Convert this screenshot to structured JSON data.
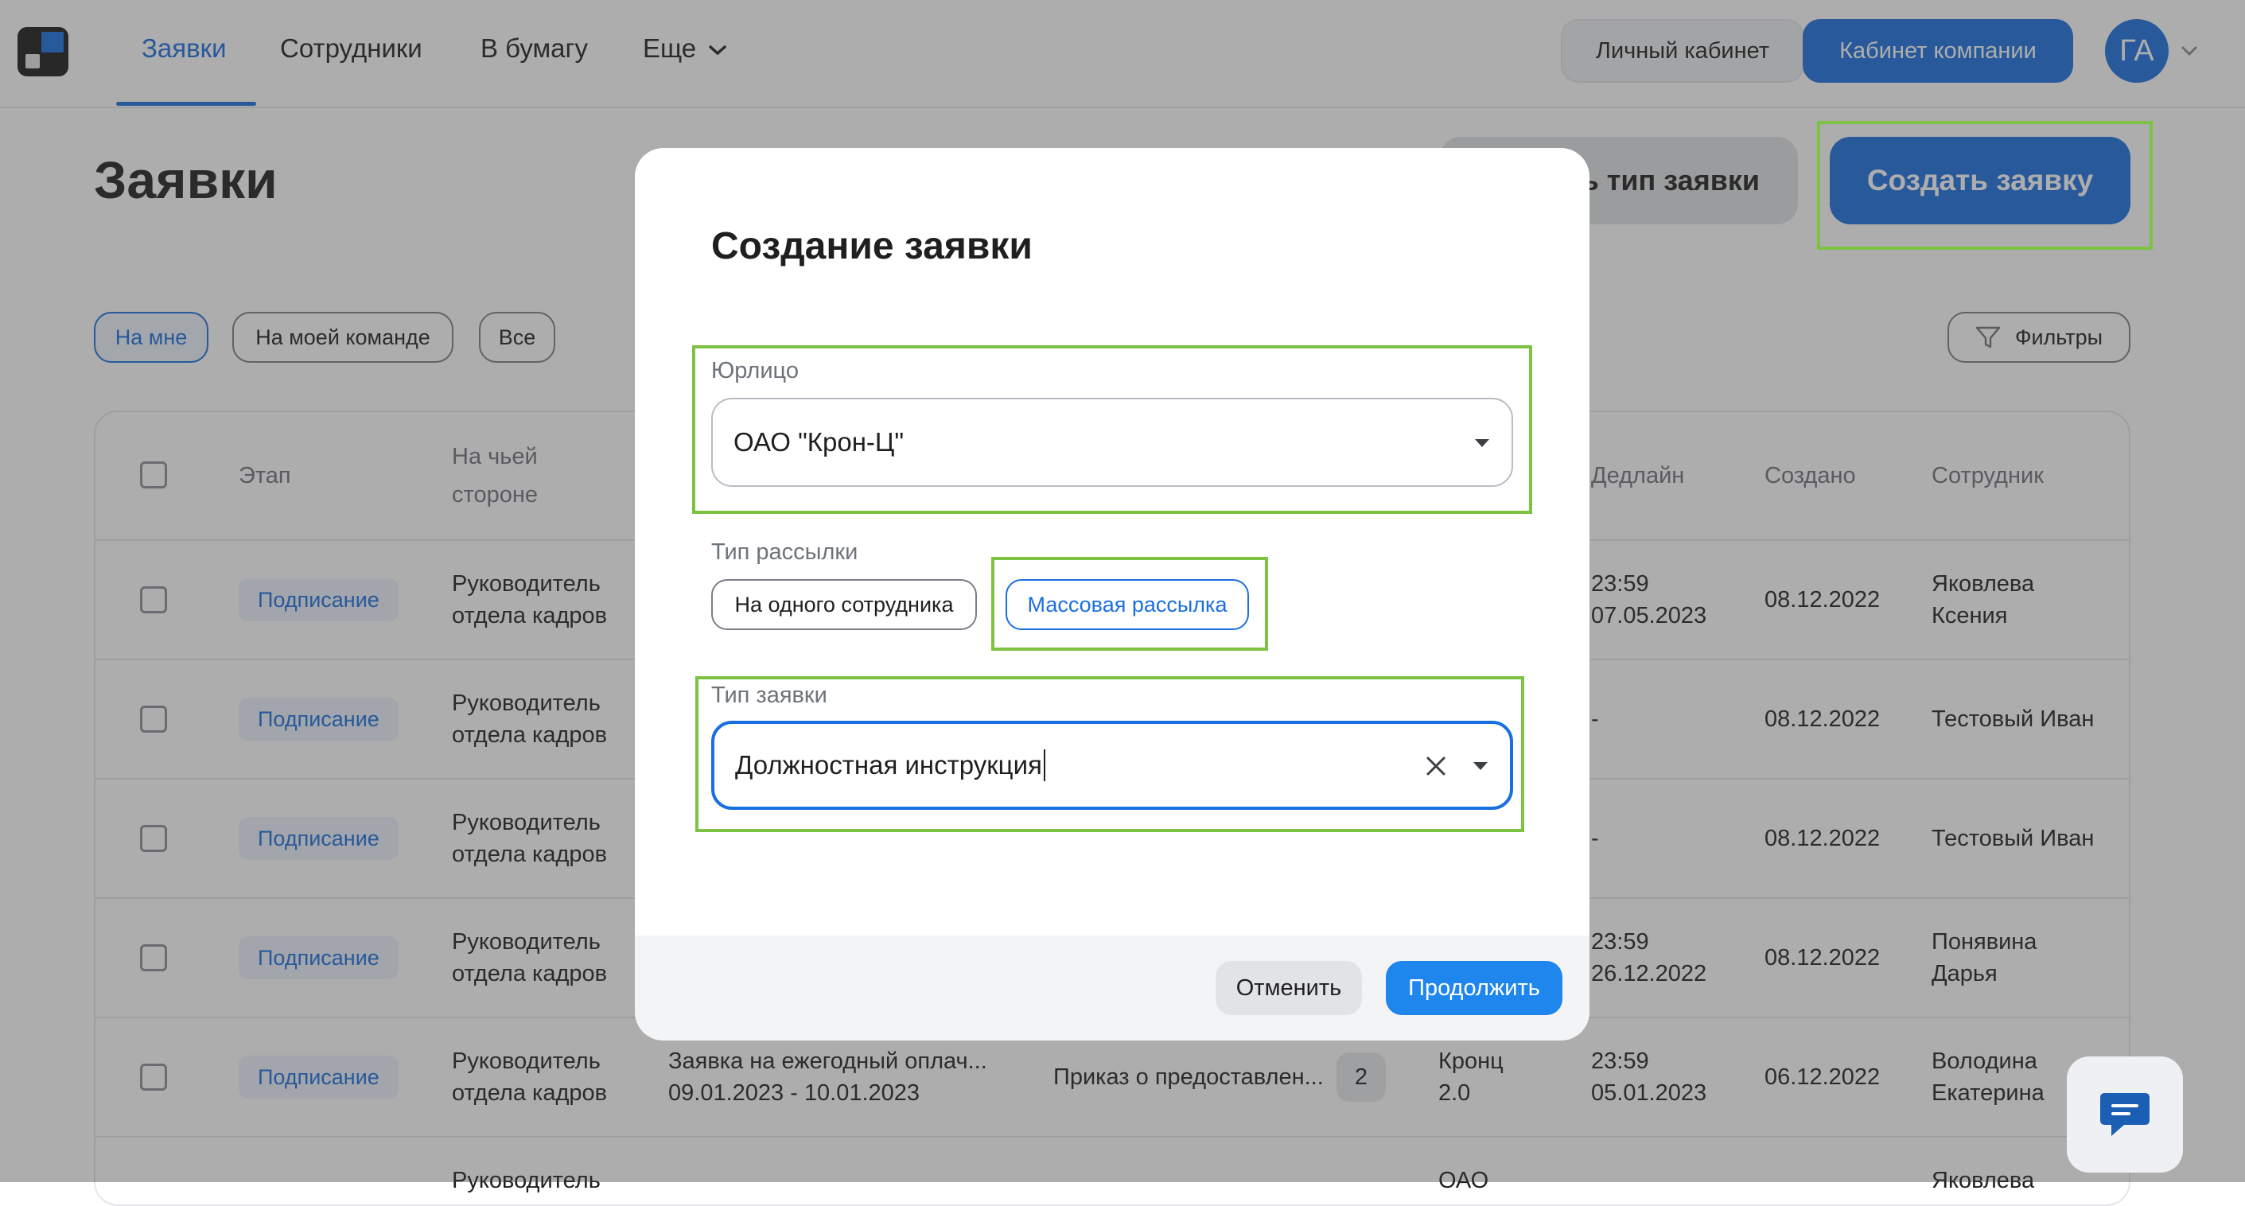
{
  "nav": {
    "items": [
      {
        "label": "Заявки",
        "active": true
      },
      {
        "label": "Сотрудники",
        "active": false
      },
      {
        "label": "В бумагу",
        "active": false
      },
      {
        "label": "Еще",
        "active": false
      }
    ],
    "personal_cabinet": "Личный кабинет",
    "company_cabinet": "Кабинет компании",
    "avatar_initials": "ГА"
  },
  "page": {
    "title": "Заявки",
    "type_button": "ь тип заявки",
    "create_button": "Создать заявку",
    "filter_chips": [
      "На мне",
      "На моей команде",
      "Все"
    ],
    "filters_button": "Фильтры"
  },
  "table": {
    "headers": {
      "stage": "Этап",
      "side_line1": "На чьей",
      "side_line2": "стороне",
      "deadline": "Дедлайн",
      "created": "Создано",
      "employee": "Сотрудник"
    },
    "rows": [
      {
        "stage": "Подписание",
        "side1": "Руководитель",
        "side2": "отдела кадров",
        "deadline1": "23:59",
        "deadline2": "07.05.2023",
        "created": "08.12.2022",
        "emp1": "Яковлева",
        "emp2": "Ксения"
      },
      {
        "stage": "Подписание",
        "side1": "Руководитель",
        "side2": "отдела кадров",
        "deadline1": "-",
        "deadline2": "",
        "created": "08.12.2022",
        "emp1": "Тестовый Иван",
        "emp2": ""
      },
      {
        "stage": "Подписание",
        "side1": "Руководитель",
        "side2": "отдела кадров",
        "deadline1": "-",
        "deadline2": "",
        "created": "08.12.2022",
        "emp1": "Тестовый Иван",
        "emp2": ""
      },
      {
        "stage": "Подписание",
        "side1": "Руководитель",
        "side2": "отдела кадров",
        "deadline1": "23:59",
        "deadline2": "26.12.2022",
        "created": "08.12.2022",
        "emp1": "Понявина",
        "emp2": "Дарья"
      },
      {
        "stage": "Подписание",
        "side1": "Руководитель",
        "side2": "отдела кадров",
        "request1": "Заявка на ежегодный оплач...",
        "request2": "09.01.2023 - 10.01.2023",
        "doc": "Приказ о предоставлен...",
        "doc_count": "2",
        "org1": "Кронц",
        "org2": "2.0",
        "deadline1": "23:59",
        "deadline2": "05.01.2023",
        "created": "06.12.2022",
        "emp1": "Володина",
        "emp2": "Екатерина"
      },
      {
        "side1": "Руководитель",
        "org1": "ОАО",
        "emp1": "Яковлева"
      }
    ]
  },
  "modal": {
    "title": "Создание заявки",
    "legal_entity_label": "Юрлицо",
    "legal_entity_value": "ОАО \"Крон-Ц\"",
    "mailing_type_label": "Тип рассылки",
    "mailing_options": [
      "На одного сотрудника",
      "Массовая рассылка"
    ],
    "request_type_label": "Тип заявки",
    "request_type_value": "Должностная инструкция",
    "cancel_button": "Отменить",
    "continue_button": "Продолжить"
  },
  "colors": {
    "accent": "#1a6fe0",
    "highlight": "#7dc242"
  }
}
